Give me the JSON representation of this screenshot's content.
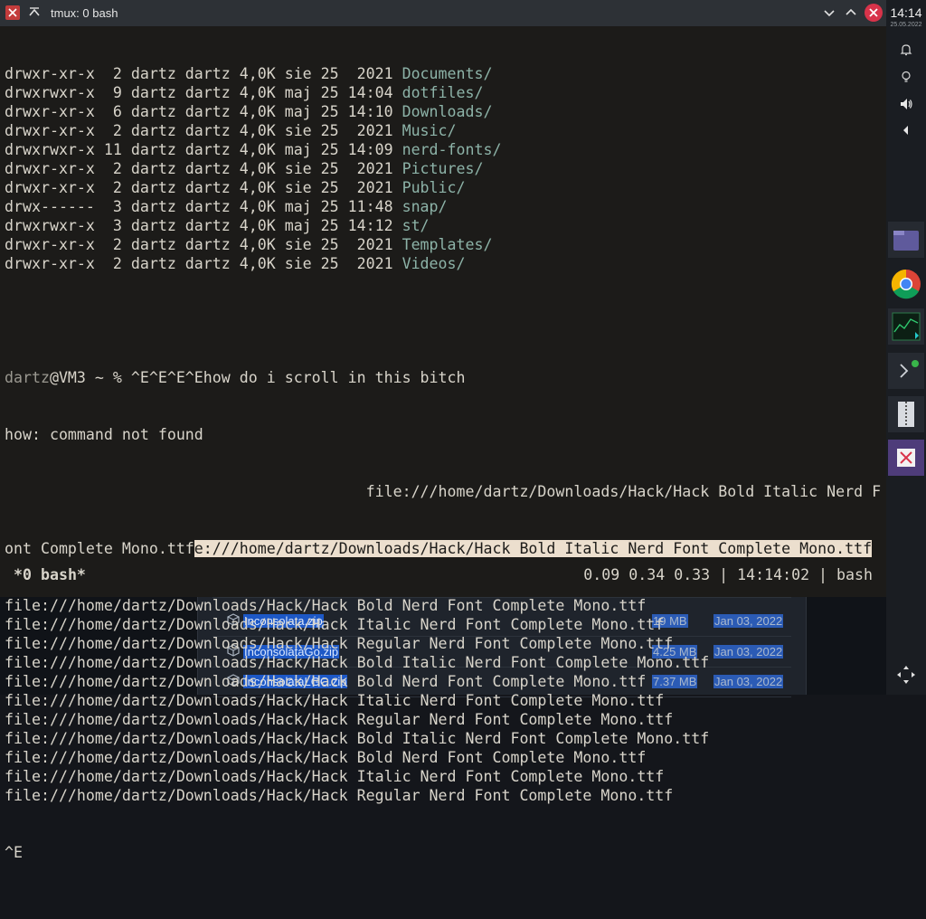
{
  "window": {
    "title": "tmux: 0 bash"
  },
  "terminal": {
    "listing": [
      {
        "perms": "drwxr-xr-x",
        "links": " 2",
        "owner": "dartz",
        "group": "dartz",
        "size": "4,0K",
        "month": "sie",
        "day": "25",
        "time": " 2021",
        "name": "Documents/"
      },
      {
        "perms": "drwxrwxr-x",
        "links": " 9",
        "owner": "dartz",
        "group": "dartz",
        "size": "4,0K",
        "month": "maj",
        "day": "25",
        "time": "14:04",
        "name": "dotfiles/"
      },
      {
        "perms": "drwxr-xr-x",
        "links": " 6",
        "owner": "dartz",
        "group": "dartz",
        "size": "4,0K",
        "month": "maj",
        "day": "25",
        "time": "14:10",
        "name": "Downloads/"
      },
      {
        "perms": "drwxr-xr-x",
        "links": " 2",
        "owner": "dartz",
        "group": "dartz",
        "size": "4,0K",
        "month": "sie",
        "day": "25",
        "time": " 2021",
        "name": "Music/"
      },
      {
        "perms": "drwxrwxr-x",
        "links": "11",
        "owner": "dartz",
        "group": "dartz",
        "size": "4,0K",
        "month": "maj",
        "day": "25",
        "time": "14:09",
        "name": "nerd-fonts/"
      },
      {
        "perms": "drwxr-xr-x",
        "links": " 2",
        "owner": "dartz",
        "group": "dartz",
        "size": "4,0K",
        "month": "sie",
        "day": "25",
        "time": " 2021",
        "name": "Pictures/"
      },
      {
        "perms": "drwxr-xr-x",
        "links": " 2",
        "owner": "dartz",
        "group": "dartz",
        "size": "4,0K",
        "month": "sie",
        "day": "25",
        "time": " 2021",
        "name": "Public/"
      },
      {
        "perms": "drwx------",
        "links": " 3",
        "owner": "dartz",
        "group": "dartz",
        "size": "4,0K",
        "month": "maj",
        "day": "25",
        "time": "11:48",
        "name": "snap/"
      },
      {
        "perms": "drwxrwxr-x",
        "links": " 3",
        "owner": "dartz",
        "group": "dartz",
        "size": "4,0K",
        "month": "maj",
        "day": "25",
        "time": "14:12",
        "name": "st/"
      },
      {
        "perms": "drwxr-xr-x",
        "links": " 2",
        "owner": "dartz",
        "group": "dartz",
        "size": "4,0K",
        "month": "sie",
        "day": "25",
        "time": " 2021",
        "name": "Templates/"
      },
      {
        "perms": "drwxr-xr-x",
        "links": " 2",
        "owner": "dartz",
        "group": "dartz",
        "size": "4,0K",
        "month": "sie",
        "day": "25",
        "time": " 2021",
        "name": "Videos/"
      }
    ],
    "prompt_user": "dartz",
    "prompt_rest": "@VM3 ~ % ^E^E^E^Ehow do i scroll in this bitch",
    "error_line": "how: command not found",
    "wrapped_first": "                                        file:///home/dartz/Downloads/Hack/Hack Bold Italic Nerd F",
    "wrapped_second_plain": "ont Complete Mono.ttf",
    "wrapped_second_highlight": "e:///home/dartz/Downloads/Hack/Hack Bold Italic Nerd Font Complete Mono.ttf",
    "file_lines": [
      "file:///home/dartz/Downloads/Hack/Hack Bold Nerd Font Complete Mono.ttf",
      "file:///home/dartz/Downloads/Hack/Hack Italic Nerd Font Complete Mono.ttf",
      "file:///home/dartz/Downloads/Hack/Hack Regular Nerd Font Complete Mono.ttf",
      "file:///home/dartz/Downloads/Hack/Hack Bold Italic Nerd Font Complete Mono.ttf",
      "file:///home/dartz/Downloads/Hack/Hack Bold Nerd Font Complete Mono.ttf",
      "file:///home/dartz/Downloads/Hack/Hack Italic Nerd Font Complete Mono.ttf",
      "file:///home/dartz/Downloads/Hack/Hack Regular Nerd Font Complete Mono.ttf",
      "file:///home/dartz/Downloads/Hack/Hack Bold Italic Nerd Font Complete Mono.ttf",
      "file:///home/dartz/Downloads/Hack/Hack Bold Nerd Font Complete Mono.ttf",
      "file:///home/dartz/Downloads/Hack/Hack Italic Nerd Font Complete Mono.ttf",
      "file:///home/dartz/Downloads/Hack/Hack Regular Nerd Font Complete Mono.ttf"
    ],
    "input_line": "^E",
    "status_left": "*0 bash*",
    "status_right": "0.09 0.34 0.33 | 14:14:02 | bash"
  },
  "downloads": [
    {
      "name": "Inconsolata.zip",
      "size": "19 MB",
      "date": "Jan 03, 2022"
    },
    {
      "name": "InconsolataGo.zip",
      "size": "4.25 MB",
      "date": "Jan 03, 2022"
    },
    {
      "name": "InconsolataLGC.zip",
      "size": "7.37 MB",
      "date": "Jan 03, 2022"
    }
  ],
  "dock": {
    "clock": "14:14",
    "date": "25.05.2022",
    "tray": [
      "bell-icon",
      "lightbulb-icon",
      "volume-icon",
      "chevron-left-icon"
    ],
    "apps": [
      "file-manager-icon",
      "chrome-icon",
      "terminal-monitor-icon",
      "terminal-icon",
      "archive-icon",
      "close-window-icon"
    ]
  },
  "colors": {
    "directory": "#8db3a8",
    "highlight_bg": "#ecdfce",
    "terminal_bg": "#1c1b19",
    "close_button": "#d8334a",
    "selection": "#1d58c6"
  }
}
